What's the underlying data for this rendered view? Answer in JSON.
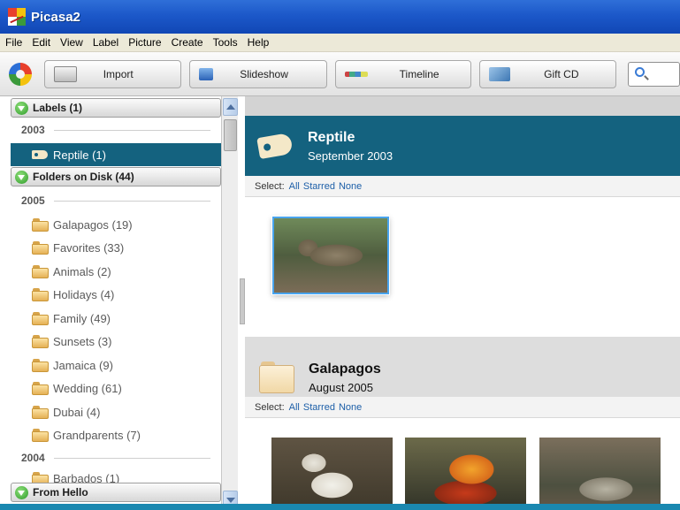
{
  "window": {
    "title": "Picasa2"
  },
  "menu": [
    "File",
    "Edit",
    "View",
    "Label",
    "Picture",
    "Create",
    "Tools",
    "Help"
  ],
  "toolbar": {
    "import_label": "Import",
    "slideshow_label": "Slideshow",
    "timeline_label": "Timeline",
    "giftcd_label": "Gift CD"
  },
  "sidebar": {
    "labels_header": "Labels (1)",
    "labels_year": "2003",
    "labels_items": [
      {
        "label": "Reptile (1)",
        "selected": true
      }
    ],
    "folders_header": "Folders on Disk (44)",
    "folders_year_2005": "2005",
    "folders_2005": [
      {
        "label": "Galapagos (19)"
      },
      {
        "label": "Favorites (33)"
      },
      {
        "label": "Animals (2)"
      },
      {
        "label": "Holidays (4)"
      },
      {
        "label": "Family (49)"
      },
      {
        "label": "Sunsets (3)"
      },
      {
        "label": "Jamaica (9)"
      },
      {
        "label": "Wedding (61)"
      },
      {
        "label": "Dubai (4)"
      },
      {
        "label": "Grandparents (7)"
      }
    ],
    "folders_year_2004": "2004",
    "folders_2004": [
      {
        "label": "Barbados (1)"
      }
    ],
    "from_hello_header": "From Hello"
  },
  "albums": [
    {
      "title": "Reptile",
      "date": "September 2003",
      "select_label": "Select:",
      "select_links": [
        "All",
        "Starred",
        "None"
      ]
    },
    {
      "title": "Galapagos",
      "date": "August 2005",
      "select_label": "Select:",
      "select_links": [
        "All",
        "Starred",
        "None"
      ]
    }
  ],
  "colors": {
    "accent_teal": "#14627f",
    "titlebar_blue": "#1c58c9",
    "link_blue": "#1d5fa8"
  }
}
